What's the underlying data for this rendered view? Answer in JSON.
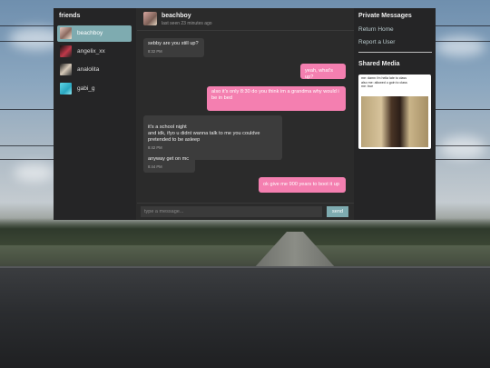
{
  "sidebar": {
    "title": "friends",
    "friends": [
      {
        "name": "beachboy",
        "active": true
      },
      {
        "name": "angelix_xx",
        "active": false
      },
      {
        "name": "analolita",
        "active": false
      },
      {
        "name": "gabi_g",
        "active": false
      }
    ]
  },
  "chat": {
    "contact_name": "beachboy",
    "last_seen": "last seen 23 minutes ago",
    "messages": [
      {
        "from": "them",
        "text": "sebby are you still up?",
        "time": "8:32 PM"
      },
      {
        "from": "me",
        "text": "yeah, what's up?"
      },
      {
        "from": "me",
        "text": "also it's only 8:30 do you think im a grandma why would i be in bed"
      },
      {
        "from": "them",
        "text": "it's a school night\nand idk, ifyo u didnt wanna talk to me you couldve pretended to be asleep",
        "time": "8:42 PM"
      },
      {
        "from": "them",
        "text": "anyway get on mc",
        "time": "8:44 PM"
      },
      {
        "from": "me",
        "text": "ok give me 900 years to boot it up"
      }
    ],
    "composer": {
      "placeholder": "type a message...",
      "send_label": "send"
    }
  },
  "right_panel": {
    "title": "Private Messages",
    "links": [
      "Return Home",
      "Report a User"
    ],
    "media_title": "Shared Media",
    "media_caption": "me: damn i'm hella late to class\nalso me: allowed u goin to class\nme: true"
  },
  "colors": {
    "accent": "#7eabb0",
    "outgoing_bubble": "#f47fb0",
    "incoming_bubble": "#3c3c3c",
    "panel": "#252526"
  }
}
